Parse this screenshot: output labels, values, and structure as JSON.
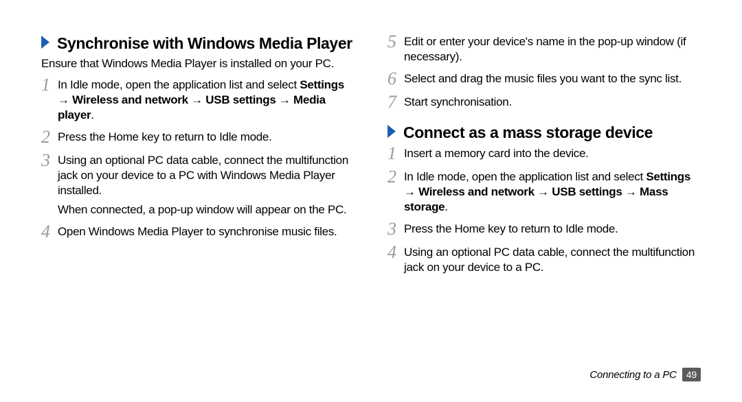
{
  "left": {
    "heading": "Synchronise with Windows Media Player",
    "intro": "Ensure that Windows Media Player is installed on your PC.",
    "steps": [
      {
        "num": "1",
        "runs": [
          {
            "text": "In Idle mode, open the application list and select ",
            "strong": false
          },
          {
            "text": "Settings",
            "strong": true
          },
          {
            "text": " → ",
            "strong": false
          },
          {
            "text": "Wireless and network",
            "strong": true
          },
          {
            "text": " → ",
            "strong": false
          },
          {
            "text": "USB settings",
            "strong": true
          },
          {
            "text": " → ",
            "strong": false
          },
          {
            "text": "Media player",
            "strong": true
          },
          {
            "text": ".",
            "strong": false
          }
        ]
      },
      {
        "num": "2",
        "runs": [
          {
            "text": "Press the Home key to return to Idle mode.",
            "strong": false
          }
        ]
      },
      {
        "num": "3",
        "runs": [
          {
            "text": "Using an optional PC data cable, connect the multifunction jack on your device to a PC with Windows Media Player installed.",
            "strong": false
          }
        ],
        "sub": [
          {
            "text": "When connected, a pop-up window will appear on the PC.",
            "strong": false
          }
        ]
      },
      {
        "num": "4",
        "runs": [
          {
            "text": "Open Windows Media Player to synchronise music files.",
            "strong": false
          }
        ]
      }
    ]
  },
  "right_top_steps": [
    {
      "num": "5",
      "runs": [
        {
          "text": "Edit or enter your device's name in the pop-up window (if necessary).",
          "strong": false
        }
      ]
    },
    {
      "num": "6",
      "runs": [
        {
          "text": "Select and drag the music files you want to the sync list.",
          "strong": false
        }
      ]
    },
    {
      "num": "7",
      "runs": [
        {
          "text": "Start synchronisation.",
          "strong": false
        }
      ]
    }
  ],
  "right": {
    "heading": "Connect as a mass storage device",
    "steps": [
      {
        "num": "1",
        "runs": [
          {
            "text": "Insert a memory card into the device.",
            "strong": false
          }
        ]
      },
      {
        "num": "2",
        "runs": [
          {
            "text": "In Idle mode, open the application list and select ",
            "strong": false
          },
          {
            "text": "Settings",
            "strong": true
          },
          {
            "text": " → ",
            "strong": false
          },
          {
            "text": "Wireless and network",
            "strong": true
          },
          {
            "text": " → ",
            "strong": false
          },
          {
            "text": "USB settings",
            "strong": true
          },
          {
            "text": " → ",
            "strong": false
          },
          {
            "text": "Mass storage",
            "strong": true
          },
          {
            "text": ".",
            "strong": false
          }
        ]
      },
      {
        "num": "3",
        "runs": [
          {
            "text": "Press the Home key to return to Idle mode.",
            "strong": false
          }
        ]
      },
      {
        "num": "4",
        "runs": [
          {
            "text": "Using an optional PC data cable, connect the multifunction jack on your device to a PC.",
            "strong": false
          }
        ]
      }
    ]
  },
  "footer": {
    "section": "Connecting to a PC",
    "page": "49"
  }
}
